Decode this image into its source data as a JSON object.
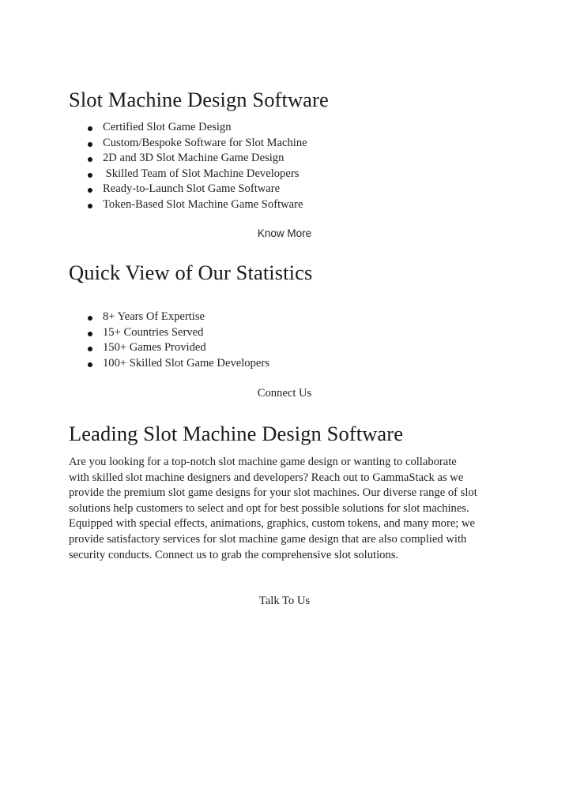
{
  "section1": {
    "heading": "Slot Machine Design Software",
    "bullets": [
      "Certified Slot Game Design",
      "Custom/Bespoke Software for Slot Machine",
      "2D and 3D Slot Machine Game Design",
      " Skilled Team of Slot Machine Developers",
      "Ready-to-Launch Slot Game Software",
      "Token-Based Slot Machine Game Software"
    ],
    "link_label": "Know More"
  },
  "section2": {
    "heading": "Quick View of Our Statistics",
    "bullets": [
      "8+ Years Of Expertise",
      "15+ Countries Served",
      "150+ Games Provided",
      "100+ Skilled Slot Game Developers"
    ],
    "link_label": "Connect Us"
  },
  "section3": {
    "heading": "Leading Slot Machine Design Software",
    "paragraph_lines": [
      "Are you looking for a top-notch slot machine game design or wanting to collaborate",
      "with skilled slot machine designers and developers? Reach out to GammaStack as we",
      "provide the premium slot game designs for your slot machines. Our diverse range of slot",
      "solutions help customers to select and opt for best possible solutions for slot machines.",
      "Equipped with special effects, animations, graphics, custom tokens, and many more; we",
      "provide satisfactory services for slot machine game design that are also complied with",
      "security conducts. Connect us to grab the comprehensive slot solutions."
    ],
    "link_label": "Talk To Us"
  }
}
